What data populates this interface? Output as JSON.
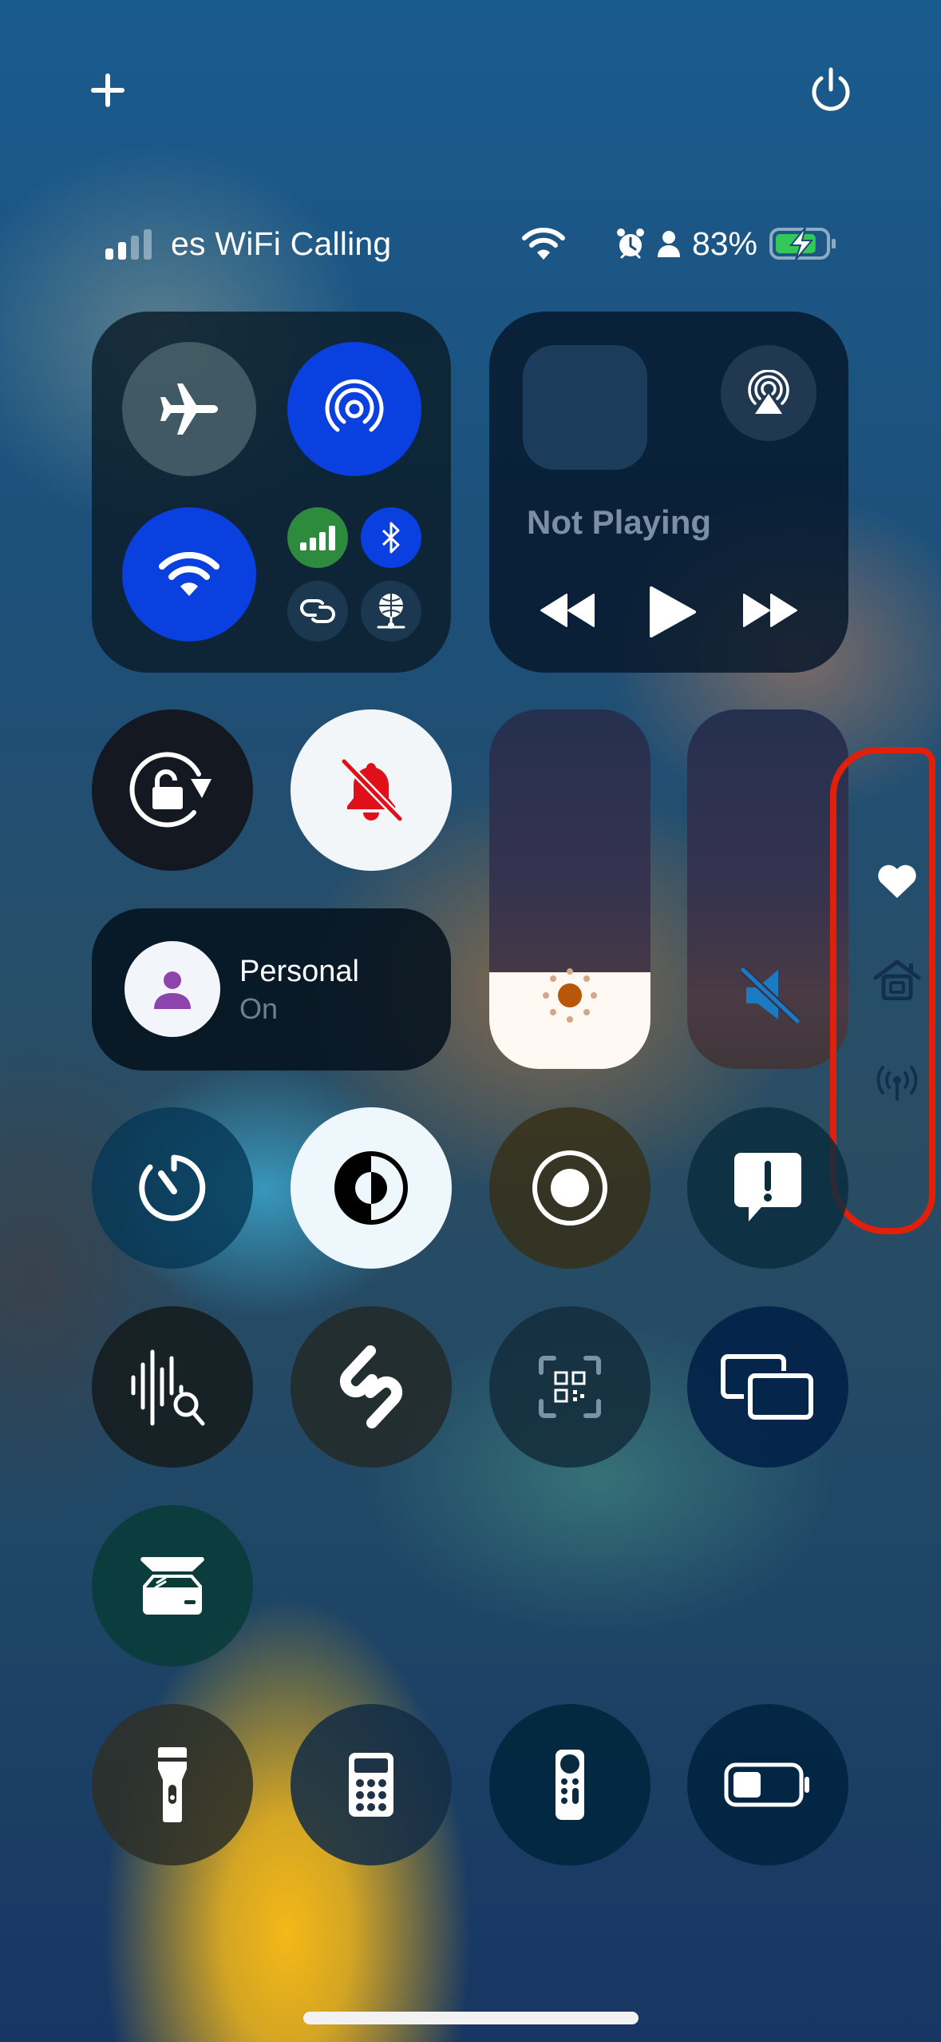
{
  "top_controls": {
    "add_icon": "plus-icon",
    "power_icon": "power-icon"
  },
  "status_bar": {
    "carrier": "es WiFi Calling",
    "signal_bars_active": 2,
    "signal_bars_total": 4,
    "wifi_icon": "wifi-icon",
    "alarm_icon": "alarm-icon",
    "person_icon": "person-icon",
    "battery_percent": "83%",
    "battery_level": 0.83,
    "charging": true,
    "battery_color": "#34c759"
  },
  "connectivity": {
    "airplane_mode": {
      "icon": "airplane-icon",
      "on": false
    },
    "airdrop": {
      "icon": "airdrop-icon",
      "on": true
    },
    "wifi": {
      "icon": "wifi-icon",
      "on": true
    },
    "cellular": {
      "icon": "cellular-icon",
      "on": true,
      "color": "#2e8b3e"
    },
    "bluetooth": {
      "icon": "bluetooth-icon",
      "on": true
    },
    "personal_hotspot": {
      "icon": "link-icon",
      "on": false
    },
    "vpn": {
      "icon": "globe-network-icon",
      "on": false
    },
    "accent_color": "#0a3fe0"
  },
  "now_playing": {
    "title": "Not Playing",
    "airplay_icon": "airplay-icon",
    "controls": [
      "rewind-icon",
      "play-icon",
      "fast-forward-icon"
    ]
  },
  "orientation_lock": {
    "icon": "rotation-lock-icon",
    "on": false
  },
  "silent_mode": {
    "icon": "bell-slash-icon",
    "on": true,
    "color": "#e0101a"
  },
  "focus": {
    "label": "Personal",
    "status": "On",
    "icon": "person-icon",
    "color": "#8e44ad"
  },
  "brightness": {
    "icon": "sun-icon",
    "level": 0.27,
    "icon_color": "#b8560a"
  },
  "volume": {
    "icon": "speaker-slash-icon",
    "level": 0.0,
    "icon_color": "#1a7bc0"
  },
  "side_pages": {
    "items": [
      {
        "icon": "heart-icon",
        "active": true
      },
      {
        "icon": "home-icon",
        "active": false
      },
      {
        "icon": "antenna-icon",
        "active": false
      }
    ],
    "annotation_color": "#e0200a"
  },
  "controls_grid": [
    {
      "name": "timer",
      "icon": "timer-icon"
    },
    {
      "name": "dark-mode",
      "icon": "dark-mode-icon",
      "on": true
    },
    {
      "name": "screen-recording",
      "icon": "record-icon"
    },
    {
      "name": "feedback",
      "icon": "feedback-icon"
    },
    {
      "name": "sound-recognition",
      "icon": "sound-recognition-icon"
    },
    {
      "name": "shazam",
      "icon": "shazam-icon"
    },
    {
      "name": "code-scanner",
      "icon": "qr-scanner-icon"
    },
    {
      "name": "screen-mirroring",
      "icon": "screen-mirroring-icon"
    },
    {
      "name": "scan-document",
      "icon": "scanner-icon"
    },
    {
      "name": "flashlight",
      "icon": "flashlight-icon"
    },
    {
      "name": "calculator",
      "icon": "calculator-icon"
    },
    {
      "name": "apple-tv-remote",
      "icon": "remote-icon"
    },
    {
      "name": "low-power-mode",
      "icon": "battery-icon"
    }
  ]
}
